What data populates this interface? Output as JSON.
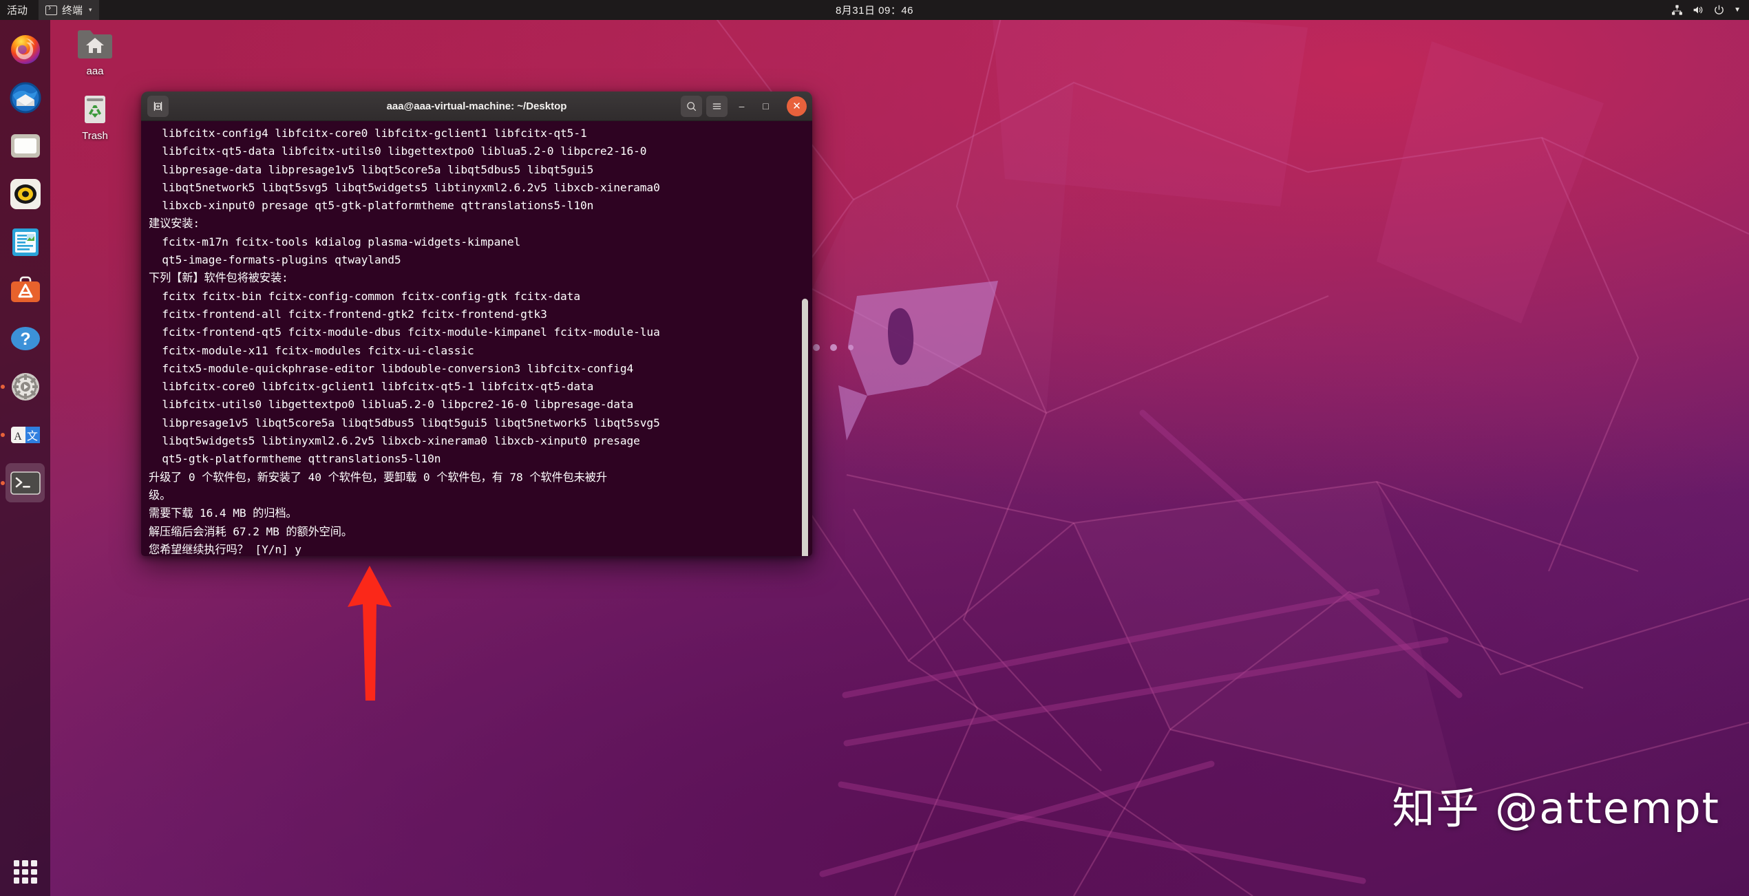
{
  "top_panel": {
    "activities_label": "活动",
    "app_menu_label": "终端",
    "clock": "8月31日  09：46",
    "tray_icons": [
      "network-icon",
      "volume-icon",
      "power-icon",
      "chevron-down-icon"
    ]
  },
  "dock": {
    "items": [
      {
        "name": "firefox",
        "label": "Firefox",
        "running": false
      },
      {
        "name": "thunderbird",
        "label": "Thunderbird Mail",
        "running": false
      },
      {
        "name": "files",
        "label": "Files",
        "running": false
      },
      {
        "name": "rhythmbox",
        "label": "Rhythmbox",
        "running": false
      },
      {
        "name": "libreoffice-writer",
        "label": "LibreOffice Writer",
        "running": false
      },
      {
        "name": "ubuntu-software",
        "label": "Ubuntu Software",
        "running": false
      },
      {
        "name": "help",
        "label": "Help",
        "running": false
      },
      {
        "name": "settings",
        "label": "Settings",
        "running": true
      },
      {
        "name": "language-selector",
        "label": "Language Support",
        "running": true
      },
      {
        "name": "terminal",
        "label": "Terminal",
        "running": true,
        "active": true
      }
    ],
    "apps_grid_label": "Show Applications"
  },
  "desktop_icons": [
    {
      "name": "home-folder",
      "label": "aaa"
    },
    {
      "name": "trash",
      "label": "Trash"
    }
  ],
  "terminal": {
    "title": "aaa@aaa-virtual-machine: ~/Desktop",
    "new_tab_label": "New Tab",
    "search_label": "Search",
    "menu_label": "Menu",
    "minimize_label": "–",
    "maximize_label": "□",
    "close_label": "✕",
    "background_color": "#2e0322",
    "text_color": "#ffffff",
    "content": "  libfcitx-config4 libfcitx-core0 libfcitx-gclient1 libfcitx-qt5-1\n  libfcitx-qt5-data libfcitx-utils0 libgettextpo0 liblua5.2-0 libpcre2-16-0\n  libpresage-data libpresage1v5 libqt5core5a libqt5dbus5 libqt5gui5\n  libqt5network5 libqt5svg5 libqt5widgets5 libtinyxml2.6.2v5 libxcb-xinerama0\n  libxcb-xinput0 presage qt5-gtk-platformtheme qttranslations5-l10n\n建议安装:\n  fcitx-m17n fcitx-tools kdialog plasma-widgets-kimpanel\n  qt5-image-formats-plugins qtwayland5\n下列【新】软件包将被安装:\n  fcitx fcitx-bin fcitx-config-common fcitx-config-gtk fcitx-data\n  fcitx-frontend-all fcitx-frontend-gtk2 fcitx-frontend-gtk3\n  fcitx-frontend-qt5 fcitx-module-dbus fcitx-module-kimpanel fcitx-module-lua\n  fcitx-module-x11 fcitx-modules fcitx-ui-classic\n  fcitx5-module-quickphrase-editor libdouble-conversion3 libfcitx-config4\n  libfcitx-core0 libfcitx-gclient1 libfcitx-qt5-1 libfcitx-qt5-data\n  libfcitx-utils0 libgettextpo0 liblua5.2-0 libpcre2-16-0 libpresage-data\n  libpresage1v5 libqt5core5a libqt5dbus5 libqt5gui5 libqt5network5 libqt5svg5\n  libqt5widgets5 libtinyxml2.6.2v5 libxcb-xinerama0 libxcb-xinput0 presage\n  qt5-gtk-platformtheme qttranslations5-l10n\n升级了 0 个软件包，新安装了 40 个软件包，要卸载 0 个软件包，有 78 个软件包未被升\n级。\n需要下载 16.4 MB 的归档。\n解压缩后会消耗 67.2 MB 的额外空间。\n您希望继续执行吗？ [Y/n] y",
    "stats": {
      "upgraded": 0,
      "newly_installed": 40,
      "to_remove": 0,
      "not_upgraded": 78,
      "download_size": "16.4 MB",
      "disk_space": "67.2 MB",
      "prompt": "[Y/n]",
      "answer": "y"
    }
  },
  "annotation": {
    "arrow_color": "#fb2819",
    "arrow_direction": "up",
    "points_at": "terminal-prompt-answer"
  },
  "watermark": {
    "text": "知乎 @attempt"
  }
}
